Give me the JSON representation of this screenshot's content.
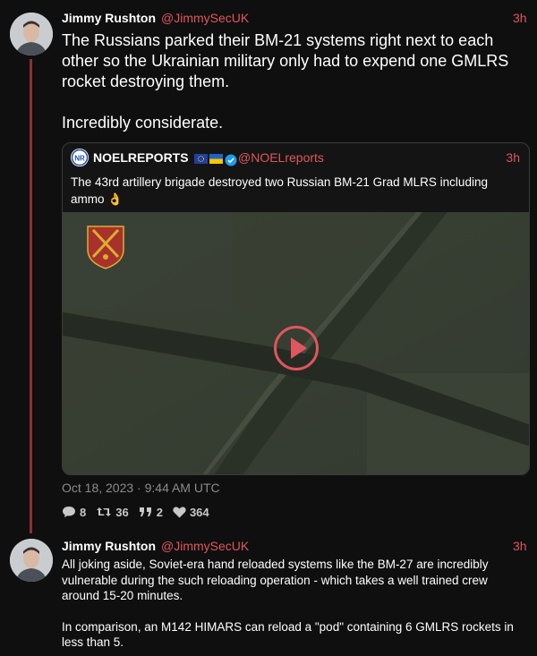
{
  "tweet1": {
    "name": "Jimmy Rushton",
    "handle": "@JimmySecUK",
    "time": "3h",
    "text_lines": [
      "The Russians parked their BM-21 systems right next to each",
      "other so the Ukrainian military only had to expend one GMLRS",
      "rocket destroying them."
    ],
    "text_line2": "Incredibly considerate.",
    "date": "Oct 18, 2023 · 9:44 AM UTC",
    "stats": {
      "replies": "8",
      "retweets": "36",
      "quotes": "2",
      "likes": "364"
    }
  },
  "quote": {
    "name": "NOELREPORTS",
    "flags": "🇪🇺 🇺🇦",
    "handle": "@NOELreports",
    "time": "3h",
    "text": "The 43rd artillery brigade destroyed two Russian BM-21 Grad MLRS including ammo 👌"
  },
  "tweet2": {
    "name": "Jimmy Rushton",
    "handle": "@JimmySecUK",
    "time": "3h",
    "para1": "All joking aside, Soviet-era hand reloaded systems like the BM-27 are incredibly vulnerable during the such reloading operation - which takes a well trained crew around 15-20 minutes.",
    "para2": "In comparison, an M142 HIMARS can reload a \"pod\" containing 6 GMLRS rockets in less than 5."
  },
  "colors": {
    "accent": "#e0565e",
    "thread": "#8c2f35",
    "play": "#e0565e"
  },
  "icons": {
    "reply": "comment-icon",
    "retweet": "retweet-icon",
    "quote": "quote-icon",
    "like": "heart-icon",
    "verified": "verified-badge-icon",
    "play": "play-icon"
  }
}
